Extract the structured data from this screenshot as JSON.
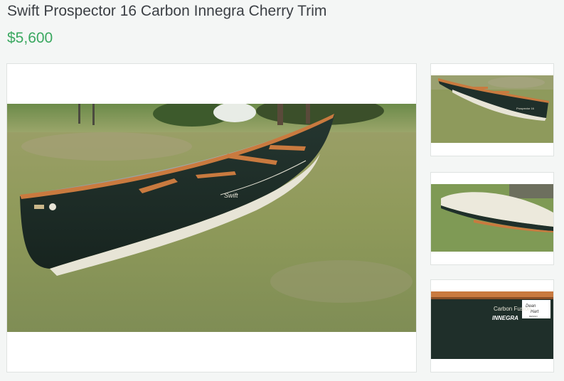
{
  "listing": {
    "title": "Swift Prospector 16 Carbon Innegra Cherry Trim",
    "price": "$5,600"
  },
  "gallery": {
    "main_photo_hull_text": "Swift",
    "thumbnails": [
      {
        "hull_text": "Prospector 16"
      },
      {
        "hull_text": ""
      },
      {
        "line1": "Carbon Fusion",
        "line2": "INNEGRA",
        "decal_1": "Dean",
        "decal_2": "Hart",
        "decal_3": "DESIGN"
      }
    ]
  },
  "colors": {
    "price": "#3aa860",
    "title": "#3b3f44",
    "hull": "#1f2f2a",
    "cherry_trim": "#c97a3f",
    "grass": "#8e9a5c"
  }
}
